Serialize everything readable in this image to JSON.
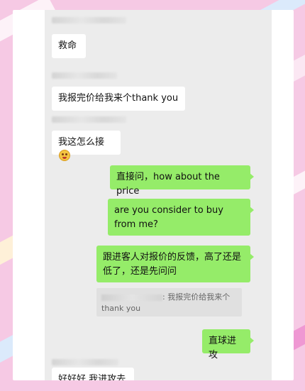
{
  "messages": [
    {
      "side": "left",
      "text": "救命"
    },
    {
      "side": "left",
      "text": "我报完价给我来个thank you"
    },
    {
      "side": "left",
      "text": "我这怎么接",
      "icon": "flushed-face-emoji"
    },
    {
      "side": "right",
      "text": "直接问，how about the price"
    },
    {
      "side": "right",
      "text": "are you consider to buy from me?"
    },
    {
      "side": "right",
      "text": "跟进客人对报价的反馈，高了还是低了，还是先问问"
    },
    {
      "quote": ": 我报完价给我来个thank you"
    },
    {
      "side": "right",
      "text": "直球进攻"
    },
    {
      "side": "left",
      "text": "好好好 我进攻去"
    }
  ],
  "colors": {
    "incoming_bubble": "#ffffff",
    "outgoing_bubble": "#95ec69",
    "chat_background": "#ececec",
    "page_background": "#f6c9e4"
  }
}
